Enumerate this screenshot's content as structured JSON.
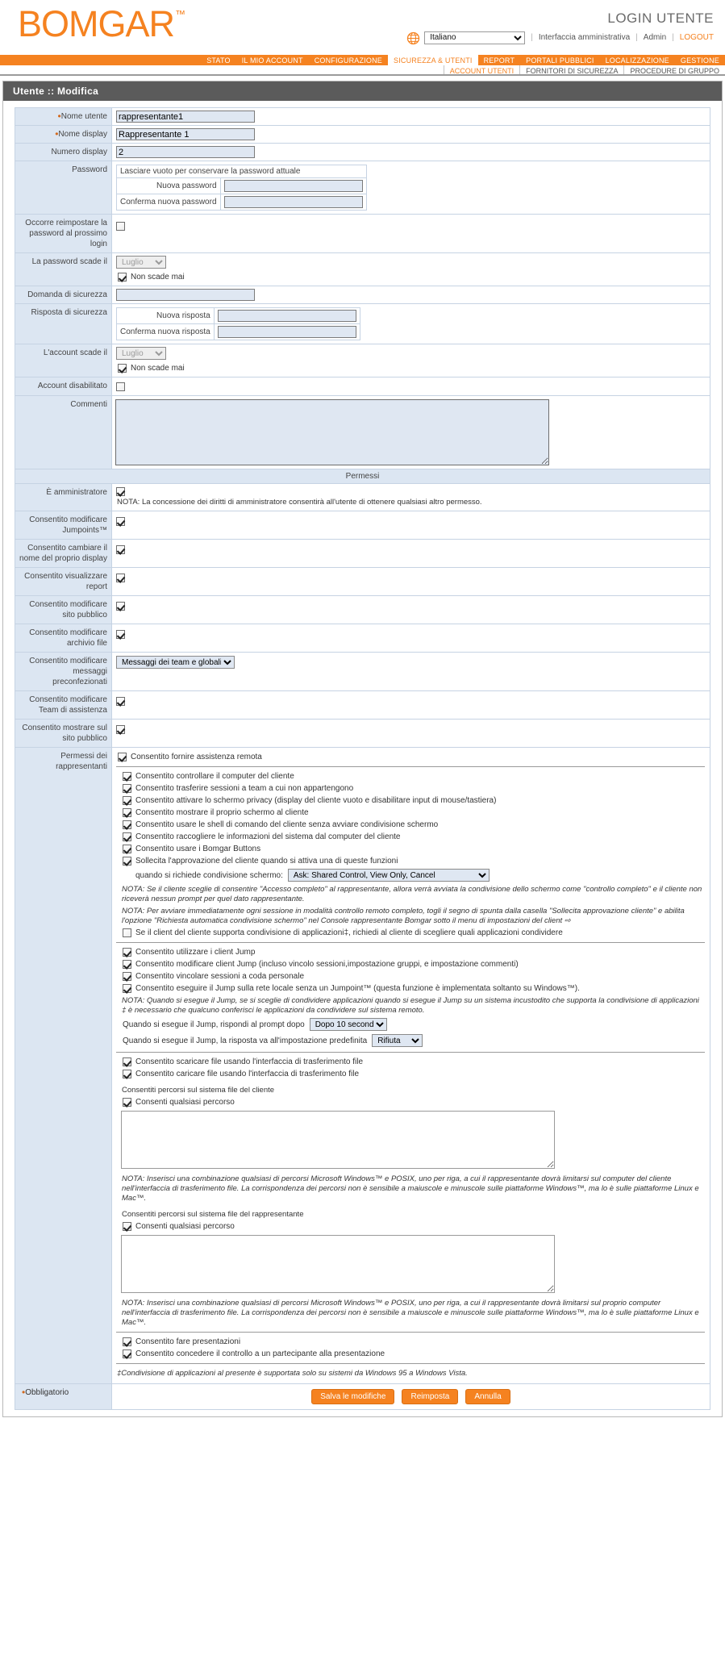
{
  "header": {
    "logo": "BOMGAR",
    "logo_tm": "™",
    "login_title": "LOGIN UTENTE",
    "globe_icon": "globe-icon",
    "language_selected": "Italiano",
    "language_options": [
      "Italiano"
    ],
    "admin_interface_link": "Interfaccia amministrativa",
    "admin_link": "Admin",
    "logout_link": "LOGOUT"
  },
  "nav": {
    "items": [
      {
        "label": "STATO",
        "active": false
      },
      {
        "label": "IL MIO ACCOUNT",
        "active": false
      },
      {
        "label": "CONFIGURAZIONE",
        "active": false
      },
      {
        "label": "SICUREZZA & UTENTI",
        "active": true
      },
      {
        "label": "REPORT",
        "active": false
      },
      {
        "label": "PORTALI PUBBLICI",
        "active": false
      },
      {
        "label": "LOCALIZZAZIONE",
        "active": false
      },
      {
        "label": "GESTIONE",
        "active": false
      }
    ],
    "subitems": [
      {
        "label": "ACCOUNT UTENTI",
        "active": true
      },
      {
        "label": "FORNITORI DI SICUREZZA",
        "active": false
      },
      {
        "label": "PROCEDURE DI GRUPPO",
        "active": false
      }
    ]
  },
  "page": {
    "title": "Utente :: Modifica"
  },
  "form": {
    "username_label": "Nome utente",
    "username_value": "rappresentante1",
    "displayname_label": "Nome display",
    "displayname_value": "Rappresentante 1",
    "displaynumber_label": "Numero display",
    "displaynumber_value": "2",
    "password_label": "Password",
    "password_note": "Lasciare vuoto per conservare la password attuale",
    "new_password_label": "Nuova password",
    "new_password_value": "",
    "confirm_password_label": "Conferma nuova password",
    "confirm_password_value": "",
    "must_reset_label": "Occorre reimpostare la password al prossimo login",
    "must_reset_checked": false,
    "password_expires_label": "La password scade il",
    "password_expires_month": "Luglio",
    "password_never_expires_label": "Non scade mai",
    "password_never_expires_checked": true,
    "security_question_label": "Domanda di sicurezza",
    "security_question_value": "",
    "security_answer_label": "Risposta di sicurezza",
    "new_answer_label": "Nuova risposta",
    "new_answer_value": "",
    "confirm_answer_label": "Conferma nuova risposta",
    "confirm_answer_value": "",
    "account_expires_label": "L'account scade il",
    "account_expires_month": "Luglio",
    "account_never_expires_label": "Non scade mai",
    "account_never_expires_checked": true,
    "account_disabled_label": "Account disabilitato",
    "account_disabled_checked": false,
    "comments_label": "Commenti",
    "comments_value": ""
  },
  "permissions": {
    "section_title": "Permessi",
    "is_admin_label": "È amministratore",
    "is_admin_checked": true,
    "is_admin_note": "NOTA: La concessione dei diritti di amministratore consentirà all'utente di ottenere qualsiasi altro permesso.",
    "rows": [
      {
        "label": "Consentito modificare Jumpoints™",
        "checked": true
      },
      {
        "label": "Consentito cambiare il nome del proprio display",
        "checked": true
      },
      {
        "label": "Consentito visualizzare report",
        "checked": true
      },
      {
        "label": "Consentito modificare sito pubblico",
        "checked": true
      },
      {
        "label": "Consentito modificare archivio file",
        "checked": true
      }
    ],
    "canned_messages_label": "Consentito modificare messaggi preconfezionati",
    "canned_messages_value": "Messaggi dei team e globali",
    "canned_messages_options": [
      "Messaggi dei team e globali"
    ],
    "rows2": [
      {
        "label": "Consentito modificare Team di assistenza",
        "checked": true
      },
      {
        "label": "Consentito mostrare sul sito pubblico",
        "checked": true
      }
    ],
    "rep_permissions_label": "Permessi dei rappresentanti",
    "rep_provide_remote_support": {
      "label": "Consentito fornire assistenza remota",
      "checked": true
    },
    "rep_group1": [
      {
        "label": "Consentito controllare il computer del cliente",
        "checked": true
      },
      {
        "label": "Consentito trasferire sessioni a team a cui non appartengono",
        "checked": true
      },
      {
        "label": "Consentito attivare lo schermo privacy (display del cliente vuoto e disabilitare input di mouse/tastiera)",
        "checked": true
      },
      {
        "label": "Consentito mostrare il proprio schermo al cliente",
        "checked": true
      },
      {
        "label": "Consentito usare le shell di comando del cliente senza avviare condivisione schermo",
        "checked": true
      },
      {
        "label": "Consentito raccogliere le informazioni del sistema dal computer del cliente",
        "checked": true
      },
      {
        "label": "Consentito usare i Bomgar Buttons",
        "checked": true
      },
      {
        "label": "Sollecita l'approvazione del cliente quando si attiva una di queste funzioni",
        "checked": true
      }
    ],
    "screen_sharing_prompt_label": "quando si richiede condivisione schermo:",
    "screen_sharing_prompt_value": "Ask: Shared Control, View Only, Cancel",
    "screen_sharing_prompt_options": [
      "Ask: Shared Control, View Only, Cancel"
    ],
    "note_1": "NOTA: Se il cliente sceglie di consentire \"Accesso completo\" al rappresentante, allora verrà avviata la condivisione dello schermo come \"controllo completo\" e il cliente non riceverà nessun prompt per quel dato rappresentante.",
    "note_2": "NOTA: Per avviare immediatamente ogni sessione in modalità controllo remoto completo, togli il segno di spunta dalla casella \"Sollecita approvazione cliente\" e abilita l'opzione \"Richiesta automatica condivisione schermo\" nel Console rappresentante Bomgar sotto il menu di impostazioni del client ⇨",
    "rep_app_sharing": {
      "label": "Se il client del cliente supporta condivisione di applicazioni‡, richiedi al cliente di scegliere quali applicazioni condividere",
      "checked": false
    },
    "rep_group2": [
      {
        "label": "Consentito utilizzare i client Jump",
        "checked": true
      },
      {
        "label": "Consentito modificare client Jump (incluso vincolo sessioni,impostazione gruppi, e impostazione commenti)",
        "checked": true
      },
      {
        "label": "Consentito vincolare sessioni a coda personale",
        "checked": true
      },
      {
        "label": "Consentito eseguire il Jump sulla rete locale senza un Jumpoint™ (questa funzione è implementata soltanto su Windows™).",
        "checked": true
      }
    ],
    "note_3": "NOTA: Quando si esegue il Jump, se si sceglie di condividere applicazioni quando si esegue il Jump su un sistema incustodito che supporta la condivisione di applicazioni ‡ è necessario che qualcuno conferisci le applicazioni da condividere sul sistema remoto.",
    "jump_prompt_label": "Quando si esegue il Jump, rispondi al prompt dopo",
    "jump_prompt_value": "Dopo 10 secondi",
    "jump_prompt_options": [
      "Dopo 10 secondi"
    ],
    "jump_default_label": "Quando si esegue il Jump, la risposta va all'impostazione predefinita",
    "jump_default_value": "Rifiuta",
    "jump_default_options": [
      "Rifiuta"
    ],
    "rep_group3": [
      {
        "label": "Consentito scaricare file usando l'interfaccia di trasferimento file",
        "checked": true
      },
      {
        "label": "Consentito caricare file usando l'interfaccia di trasferimento file",
        "checked": true
      }
    ],
    "client_paths_label": "Consentiti percorsi sul sistema file del cliente",
    "client_paths_any": {
      "label": "Consenti qualsiasi percorso",
      "checked": true
    },
    "client_paths_value": "",
    "note_4": "NOTA: Inserisci una combinazione qualsiasi di percorsi Microsoft Windows™ e POSIX, uno per riga, a cui il rappresentante dovrà limitarsi sul computer del cliente nell'interfaccia di trasferimento file. La corrispondenza dei percorsi non è sensibile a maiuscole e minuscole sulle piattaforme Windows™, ma lo è sulle piattaforme Linux e Mac™.",
    "rep_paths_label": "Consentiti percorsi sul sistema file del rappresentante",
    "rep_paths_any": {
      "label": "Consenti qualsiasi percorso",
      "checked": true
    },
    "rep_paths_value": "",
    "note_5": "NOTA: Inserisci una combinazione qualsiasi di percorsi Microsoft Windows™ e POSIX, uno per riga, a cui il rappresentante dovrà limitarsi sul proprio computer nell'interfaccia di trasferimento file. La corrispondenza dei percorsi non è sensibile a maiuscole e minuscole sulle piattaforme Windows™, ma lo è sulle piattaforme Linux e Mac™.",
    "rep_group4": [
      {
        "label": "Consentito fare presentazioni",
        "checked": true
      },
      {
        "label": "Consentito concedere il controllo a un partecipante alla presentazione",
        "checked": true
      }
    ],
    "footnote": "‡Condivisione di applicazioni al presente è supportata solo su sistemi da Windows 95 a Windows Vista."
  },
  "footer": {
    "required_label": "Obbligatorio",
    "save_button": "Salva le modifiche",
    "reset_button": "Reimposta",
    "cancel_button": "Annulla"
  }
}
